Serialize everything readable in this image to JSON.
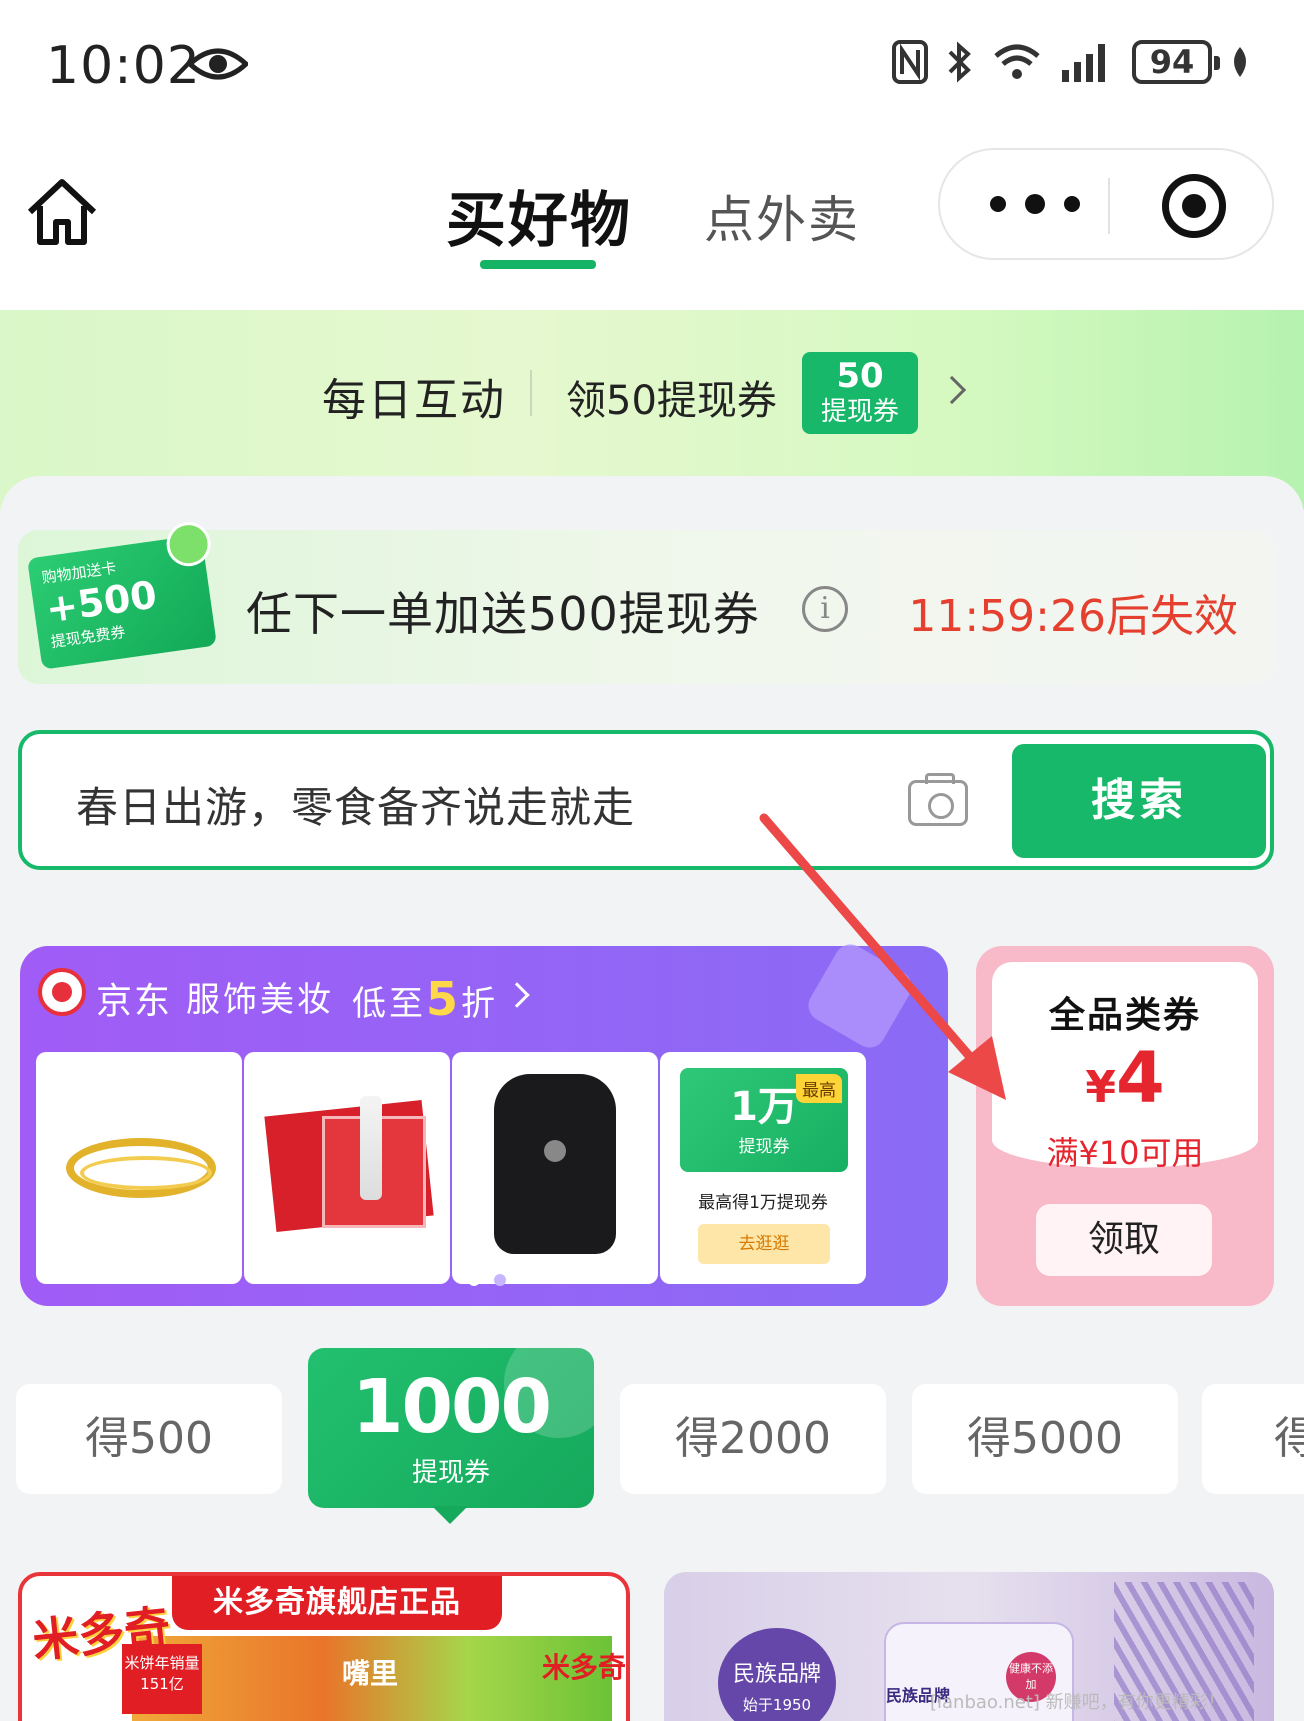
{
  "status_bar": {
    "time": "10:02",
    "battery": "94"
  },
  "nav": {
    "tab_active": "买好物",
    "tab_other": "点外卖"
  },
  "daily": {
    "title": "每日互动",
    "reward_text": "领50提现券",
    "badge_num": "50",
    "badge_label": "提现券"
  },
  "promo": {
    "card_line1": "购物加送卡",
    "card_amount": "+500",
    "card_line3": "提现免费券",
    "text": "任下一单加送500提现券",
    "info_icon": "i",
    "timer": "11:59:26后失效"
  },
  "search": {
    "placeholder": "春日出游，零食备齐说走就走",
    "button": "搜索"
  },
  "jd_banner": {
    "brand": "京东",
    "category": "服饰美妆",
    "discount_prefix": "低至",
    "discount_num": "5",
    "discount_suffix": "折",
    "coupon_tag": "最高",
    "coupon_num": "1万",
    "coupon_label": "提现券",
    "coupon_desc": "最高得1万提现券",
    "coupon_btn": "去逛逛",
    "product_images": [
      "bangle-image",
      "skincare-set-image",
      "backpack-image"
    ]
  },
  "pink_coupon": {
    "title": "全品类券",
    "currency": "¥",
    "amount": "4",
    "condition": "满¥10可用",
    "button": "领取"
  },
  "reward_tabs": {
    "tab1": "得500",
    "active_num": "1000",
    "active_label": "提现券",
    "tab3": "得2000",
    "tab4": "得5000",
    "tab5": "得"
  },
  "products": {
    "p1_head": "米多奇旗舰店正品",
    "p1_logo": "米多奇",
    "p1_tag": "米饼年销量151亿",
    "p1_mid": "嘴里",
    "p1_brand": "米多奇",
    "p2_badge": "民族品牌",
    "p2_badge_sub": "始于1950",
    "p2_text": "民族品牌",
    "p2_ring": "健康不添加"
  },
  "watermark": "[ianbao.net] 新赚吧，有你更精彩！",
  "colors": {
    "accent": "#17b86a",
    "alert": "#e5402f",
    "jd_purple": "#a15cf6",
    "coupon_pink": "#f8b9c8"
  }
}
